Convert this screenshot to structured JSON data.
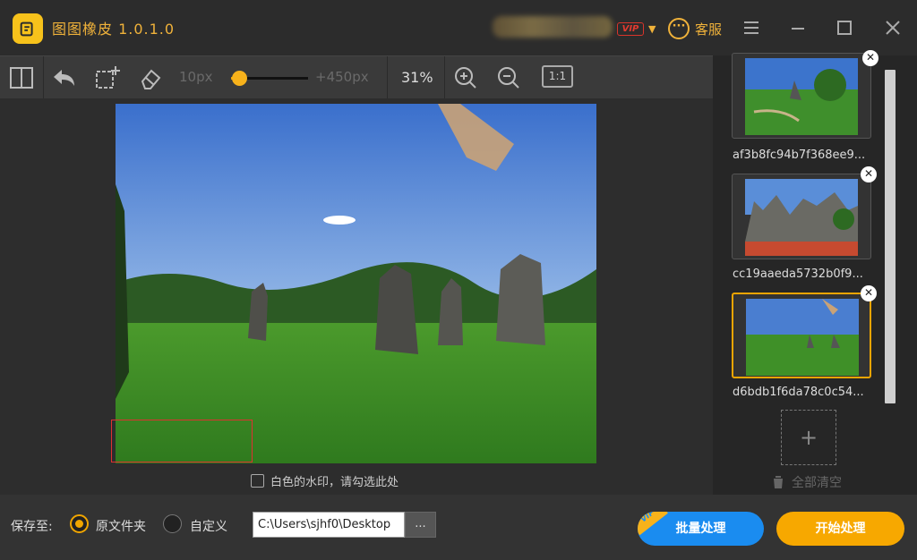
{
  "app": {
    "title": "图图橡皮  1.0.1.0",
    "vip_badge": "VIP",
    "customer_service": "客服",
    "accent": "#f0b23a"
  },
  "toolbar": {
    "brush_min": "10px",
    "brush_max": "+450px",
    "brush_level": 0.02,
    "zoom": "31%",
    "actual_size": "1:1"
  },
  "canvas": {
    "white_watermark_label": "白色的水印，请勾选此处",
    "white_watermark_checked": false
  },
  "side_panel": {
    "thumbnails": [
      {
        "name": "af3b8fc94b7f368ee9...",
        "selected": false
      },
      {
        "name": "cc19aaeda5732b0f9...",
        "selected": false
      },
      {
        "name": "d6bdb1f6da78c0c54...",
        "selected": true
      }
    ],
    "clear_all": "全部清空"
  },
  "bottom": {
    "save_to_label": "保存至:",
    "option_original": "原文件夹",
    "option_custom": "自定义",
    "selected_option": "原文件夹",
    "path_value": "C:\\Users\\sjhf0\\Desktop",
    "browse_label": "...",
    "batch_vip": "VIP",
    "batch_button": "批量处理",
    "start_button": "开始处理"
  }
}
